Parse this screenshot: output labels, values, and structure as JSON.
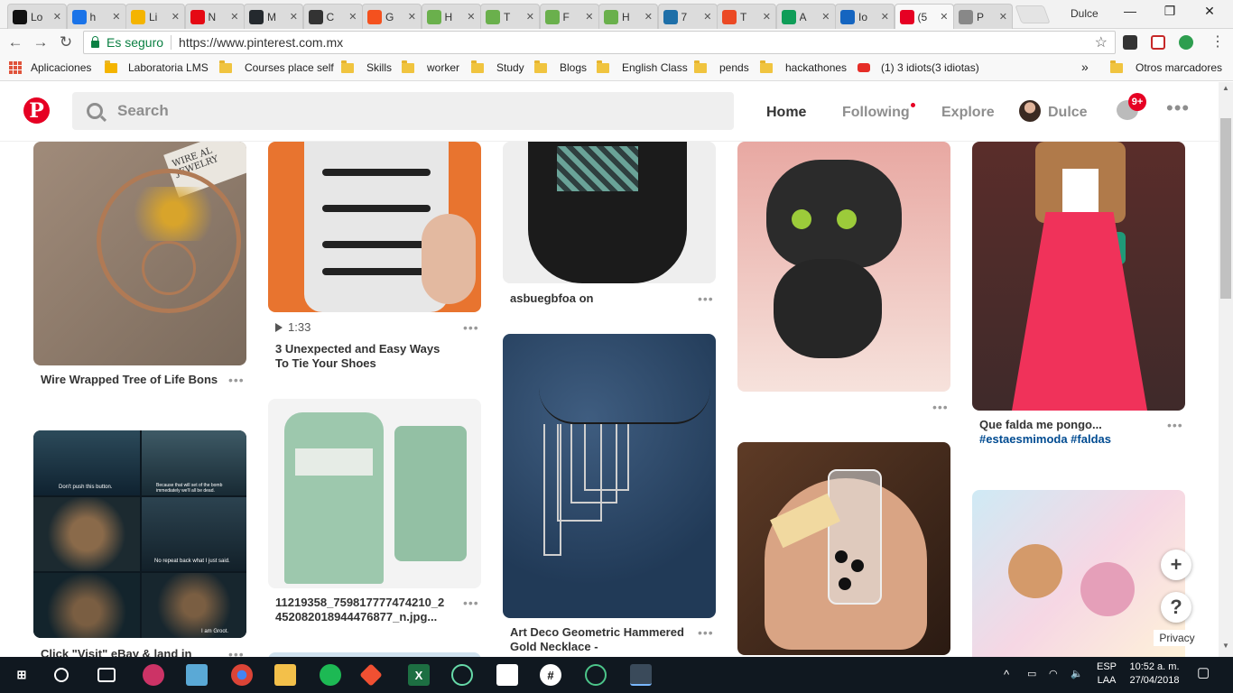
{
  "browser": {
    "tabs": [
      {
        "title": "Lo",
        "favicon_color": "#111111",
        "favicon": "alien-icon"
      },
      {
        "title": "h",
        "favicon_color": "#1a73e8",
        "favicon": "globe-icon"
      },
      {
        "title": "Li",
        "favicon_color": "#f4b400",
        "favicon": "code-icon"
      },
      {
        "title": "N",
        "favicon_color": "#e50914",
        "favicon": "netflix-icon"
      },
      {
        "title": "M",
        "favicon_color": "#24292e",
        "favicon": "github-icon"
      },
      {
        "title": "C",
        "favicon_color": "#333333",
        "favicon": "circle-icon"
      },
      {
        "title": "G",
        "favicon_color": "#f4511e",
        "favicon": "f-icon"
      },
      {
        "title": "H",
        "favicon_color": "#6ab04c",
        "favicon": "hackerrank-icon"
      },
      {
        "title": "T",
        "favicon_color": "#6ab04c",
        "favicon": "hackerrank-icon"
      },
      {
        "title": "F",
        "favicon_color": "#6ab04c",
        "favicon": "hackerrank-icon"
      },
      {
        "title": "H",
        "favicon_color": "#6ab04c",
        "favicon": "hackerrank-icon"
      },
      {
        "title": "7",
        "favicon_color": "#1e6fa8",
        "favicon": "book-icon"
      },
      {
        "title": "T",
        "favicon_color": "#eb4924",
        "favicon": "stumble-icon"
      },
      {
        "title": "A",
        "favicon_color": "#0f9d58",
        "favicon": "sheets-icon"
      },
      {
        "title": "Io",
        "favicon_color": "#1565c0",
        "favicon": "flag-icon"
      },
      {
        "title": "(5",
        "favicon_color": "#e60023",
        "favicon": "pinterest-icon"
      },
      {
        "title": "P",
        "favicon_color": "#888888",
        "favicon": "page-icon"
      }
    ],
    "profile_name": "Dulce",
    "secure_label": "Es seguro",
    "url": "https://www.pinterest.com.mx",
    "bookmarks": [
      {
        "label": "Aplicaciones",
        "type": "apps"
      },
      {
        "label": "Laboratoria LMS",
        "type": "site"
      },
      {
        "label": "Courses place self",
        "type": "folder"
      },
      {
        "label": "Skills",
        "type": "folder"
      },
      {
        "label": "worker",
        "type": "folder"
      },
      {
        "label": "Study",
        "type": "folder"
      },
      {
        "label": "Blogs",
        "type": "folder"
      },
      {
        "label": "English Class",
        "type": "folder"
      },
      {
        "label": "pends",
        "type": "folder"
      },
      {
        "label": "hackathones",
        "type": "folder"
      },
      {
        "label": "(1) 3 idiots(3 idiotas)",
        "type": "youtube"
      }
    ],
    "bookmarks_more": "»",
    "other_bookmarks": "Otros marcadores"
  },
  "header": {
    "search_placeholder": "Search",
    "nav": {
      "home": "Home",
      "following": "Following",
      "explore": "Explore"
    },
    "user_name": "Dulce",
    "notifications_badge": "9+",
    "accent_color": "#e60023"
  },
  "pins": [
    {
      "title": "Wire Wrapped Tree of Life Bons"
    },
    {
      "title": "Click \"Visit\" eBay & land in"
    },
    {
      "video_duration": "1:33",
      "title": "3 Unexpected and Easy Ways To Tie Your Shoes"
    },
    {
      "title": "11219358_759817777474210_2 452082018944476877_n.jpg..."
    },
    {
      "title": "asbuegbfoa on"
    },
    {
      "title": "Art Deco Geometric Hammered Gold Necklace -"
    },
    {
      "title_plain": "Que falda me pongo... ",
      "title_tags": "#estaesmimoda #faldas"
    }
  ],
  "image_text": {
    "jewelry_label": "WIRE AL JEWELRY",
    "groot_1": "Don't push this button.",
    "groot_2": "Because that will set of the bomb immediately we'll all be dead.",
    "groot_3": "No repeat back what I just said.",
    "groot_4": "I am Groot."
  },
  "floating": {
    "add": "+",
    "help": "?",
    "privacy": "Privacy"
  },
  "taskbar": {
    "language": "ESP",
    "layout": "LAA",
    "time": "10:52 a. m.",
    "date": "27/04/2018"
  }
}
